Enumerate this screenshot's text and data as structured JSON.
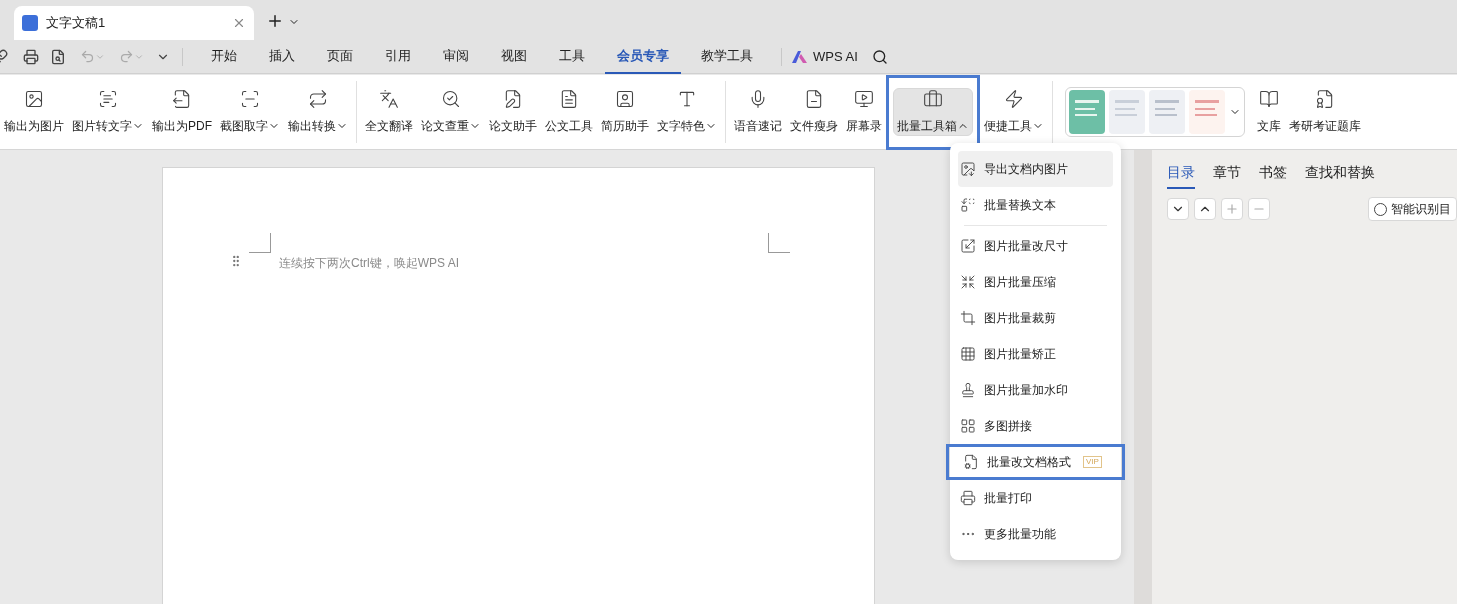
{
  "title_bar": {
    "tabs": [
      {
        "label": "文字文稿1",
        "selected": true
      }
    ]
  },
  "menu": {
    "tabs": [
      {
        "label": "开始",
        "selected": false
      },
      {
        "label": "插入",
        "selected": false
      },
      {
        "label": "页面",
        "selected": false
      },
      {
        "label": "引用",
        "selected": false
      },
      {
        "label": "审阅",
        "selected": false
      },
      {
        "label": "视图",
        "selected": false
      },
      {
        "label": "工具",
        "selected": false
      },
      {
        "label": "会员专享",
        "selected": true
      },
      {
        "label": "教学工具",
        "selected": false
      }
    ],
    "ai_label": "WPS AI"
  },
  "ribbon": {
    "groups": [
      [
        {
          "kind": "tool",
          "label": "输出为图片",
          "dropdown": false,
          "pressed": false,
          "highlighted": false
        },
        {
          "kind": "tool",
          "label": "图片转文字",
          "dropdown": true,
          "pressed": false,
          "highlighted": false
        },
        {
          "kind": "tool",
          "label": "输出为PDF",
          "dropdown": false,
          "pressed": false,
          "highlighted": false
        },
        {
          "kind": "tool",
          "label": "截图取字",
          "dropdown": true,
          "pressed": false,
          "highlighted": false
        },
        {
          "kind": "tool",
          "label": "输出转换",
          "dropdown": true,
          "pressed": false,
          "highlighted": false
        }
      ],
      [
        {
          "kind": "tool",
          "label": "全文翻译",
          "dropdown": false,
          "pressed": false,
          "highlighted": false
        },
        {
          "kind": "tool",
          "label": "论文查重",
          "dropdown": true,
          "pressed": false,
          "highlighted": false
        },
        {
          "kind": "tool",
          "label": "论文助手",
          "dropdown": false,
          "pressed": false,
          "highlighted": false
        },
        {
          "kind": "tool",
          "label": "公文工具",
          "dropdown": false,
          "pressed": false,
          "highlighted": false
        },
        {
          "kind": "tool",
          "label": "简历助手",
          "dropdown": false,
          "pressed": false,
          "highlighted": false
        },
        {
          "kind": "tool",
          "label": "文字特色",
          "dropdown": true,
          "pressed": false,
          "highlighted": false
        }
      ],
      [
        {
          "kind": "tool",
          "label": "语音速记",
          "dropdown": false,
          "pressed": false,
          "highlighted": false
        },
        {
          "kind": "tool",
          "label": "文件瘦身",
          "dropdown": false,
          "pressed": false,
          "highlighted": false
        },
        {
          "kind": "tool",
          "label": "屏幕录",
          "dropdown": false,
          "pressed": false,
          "highlighted": false
        },
        {
          "kind": "tool",
          "label": "批量工具箱",
          "dropdown": true,
          "pressed": true,
          "highlighted": true
        },
        {
          "kind": "tool",
          "label": "便捷工具",
          "dropdown": true,
          "pressed": false,
          "highlighted": false
        }
      ],
      [
        {
          "kind": "gallery"
        },
        {
          "kind": "tool",
          "label": "文库",
          "dropdown": false,
          "pressed": false,
          "highlighted": false
        },
        {
          "kind": "tool",
          "label": "考研考证题库",
          "dropdown": false,
          "pressed": false,
          "highlighted": false
        }
      ]
    ]
  },
  "document": {
    "hint": "连续按下两次Ctrl键，唤起WPS AI"
  },
  "dropdown_menu": {
    "items": [
      {
        "kind": "item",
        "label": "导出文档内图片",
        "hovered": true,
        "highlighted": false
      },
      {
        "kind": "item",
        "label": "批量替换文本",
        "hovered": false,
        "highlighted": false
      },
      {
        "kind": "separator"
      },
      {
        "kind": "item",
        "label": "图片批量改尺寸",
        "hovered": false,
        "highlighted": false
      },
      {
        "kind": "item",
        "label": "图片批量压缩",
        "hovered": false,
        "highlighted": false
      },
      {
        "kind": "item",
        "label": "图片批量裁剪",
        "hovered": false,
        "highlighted": false
      },
      {
        "kind": "item",
        "label": "图片批量矫正",
        "hovered": false,
        "highlighted": false
      },
      {
        "kind": "item",
        "label": "图片批量加水印",
        "hovered": false,
        "highlighted": false
      },
      {
        "kind": "item",
        "label": "多图拼接",
        "hovered": false,
        "highlighted": false
      },
      {
        "kind": "item",
        "label": "批量改文档格式",
        "badge": "VIP",
        "hovered": false,
        "highlighted": true
      },
      {
        "kind": "item",
        "label": "批量打印",
        "hovered": false,
        "highlighted": false
      },
      {
        "kind": "item",
        "label": "更多批量功能",
        "hovered": false,
        "highlighted": false
      }
    ]
  },
  "side_panel": {
    "tabs": [
      {
        "label": "目录",
        "selected": true
      },
      {
        "label": "章节",
        "selected": false
      },
      {
        "label": "书签",
        "selected": false
      },
      {
        "label": "查找和替换",
        "selected": false
      }
    ],
    "smart_button": "智能识别目"
  }
}
